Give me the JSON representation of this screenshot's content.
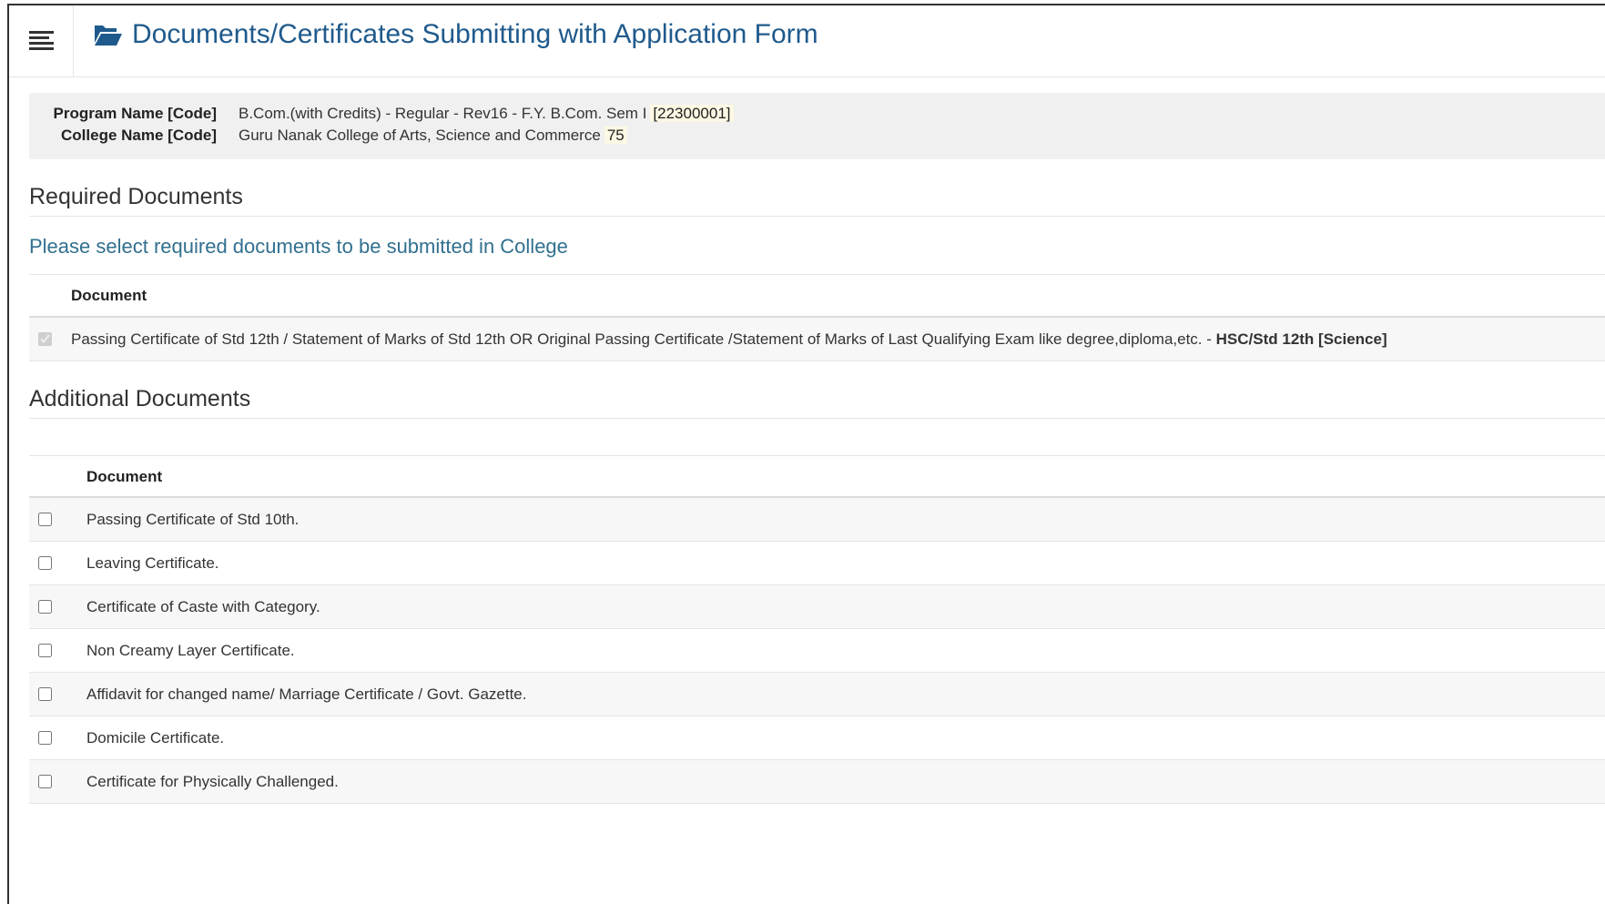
{
  "header": {
    "title": "Documents/Certificates Submitting with Application Form",
    "menu_icon": "hamburger-icon",
    "title_icon": "folder-open-icon",
    "accent_color": "#1f5a8c"
  },
  "info": {
    "program_label": "Program Name [Code]",
    "program_value": "B.Com.(with Credits) - Regular - Rev16 - F.Y. B.Com. Sem I",
    "program_code": "[22300001]",
    "college_label": "College Name [Code]",
    "college_value": "Guru Nanak College of Arts, Science and Commerce",
    "college_code": "75"
  },
  "required": {
    "title": "Required Documents",
    "subtitle": "Please select required documents to be submitted in College",
    "column_header": "Document",
    "rows": [
      {
        "text": "Passing Certificate of Std 12th / Statement of Marks of Std 12th OR Original Passing Certificate /Statement of Marks of Last Qualifying Exam like degree,diploma,etc. - ",
        "bold": "HSC/Std 12th [Science]",
        "checked": true,
        "disabled": true
      }
    ]
  },
  "additional": {
    "title": "Additional Documents",
    "column_header": "Document",
    "rows": [
      {
        "text": "Passing Certificate of Std 10th.",
        "checked": false
      },
      {
        "text": "Leaving Certificate.",
        "checked": false
      },
      {
        "text": "Certificate of Caste with Category.",
        "checked": false
      },
      {
        "text": "Non Creamy Layer Certificate.",
        "checked": false
      },
      {
        "text": "Affidavit for changed name/ Marriage Certificate / Govt. Gazette.",
        "checked": false
      },
      {
        "text": "Domicile Certificate.",
        "checked": false
      },
      {
        "text": "Certificate for Physically Challenged.",
        "checked": false
      }
    ]
  }
}
